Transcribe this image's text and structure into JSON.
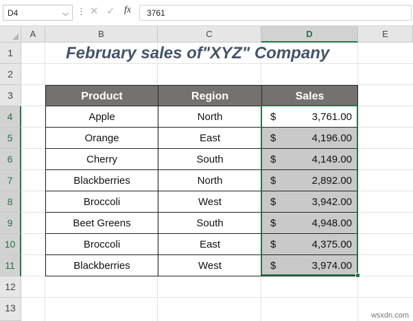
{
  "formula_bar": {
    "name_box": "D4",
    "name_box_arrow": "⌵",
    "more_dots": "⋮",
    "cancel_icon": "✕",
    "enter_icon": "✓",
    "fx_label": "fx",
    "formula_value": "3761"
  },
  "columns": [
    "A",
    "B",
    "C",
    "D",
    "E"
  ],
  "rows": [
    "1",
    "2",
    "3",
    "4",
    "5",
    "6",
    "7",
    "8",
    "9",
    "10",
    "11",
    "12",
    "13"
  ],
  "selected_column": "D",
  "sheet": {
    "title": "February sales of\"XYZ\" Company",
    "headers": {
      "product": "Product",
      "region": "Region",
      "sales": "Sales"
    },
    "currency_symbol": "$",
    "data": [
      {
        "product": "Apple",
        "region": "North",
        "sales": "3,761.00"
      },
      {
        "product": "Orange",
        "region": "East",
        "sales": "4,196.00"
      },
      {
        "product": "Cherry",
        "region": "South",
        "sales": "4,149.00"
      },
      {
        "product": "Blackberries",
        "region": "North",
        "sales": "2,892.00"
      },
      {
        "product": "Broccoli",
        "region": "West",
        "sales": "3,942.00"
      },
      {
        "product": "Beet Greens",
        "region": "South",
        "sales": "4,948.00"
      },
      {
        "product": "Broccoli",
        "region": "East",
        "sales": "4,375.00"
      },
      {
        "product": "Blackberries",
        "region": "West",
        "sales": "3,974.00"
      }
    ]
  },
  "colors": {
    "header_fill": "#767171",
    "selection_fill": "#c9c9c9",
    "accent_green": "#217346",
    "title_color": "#44546a"
  },
  "watermark": "wsxdn.com"
}
